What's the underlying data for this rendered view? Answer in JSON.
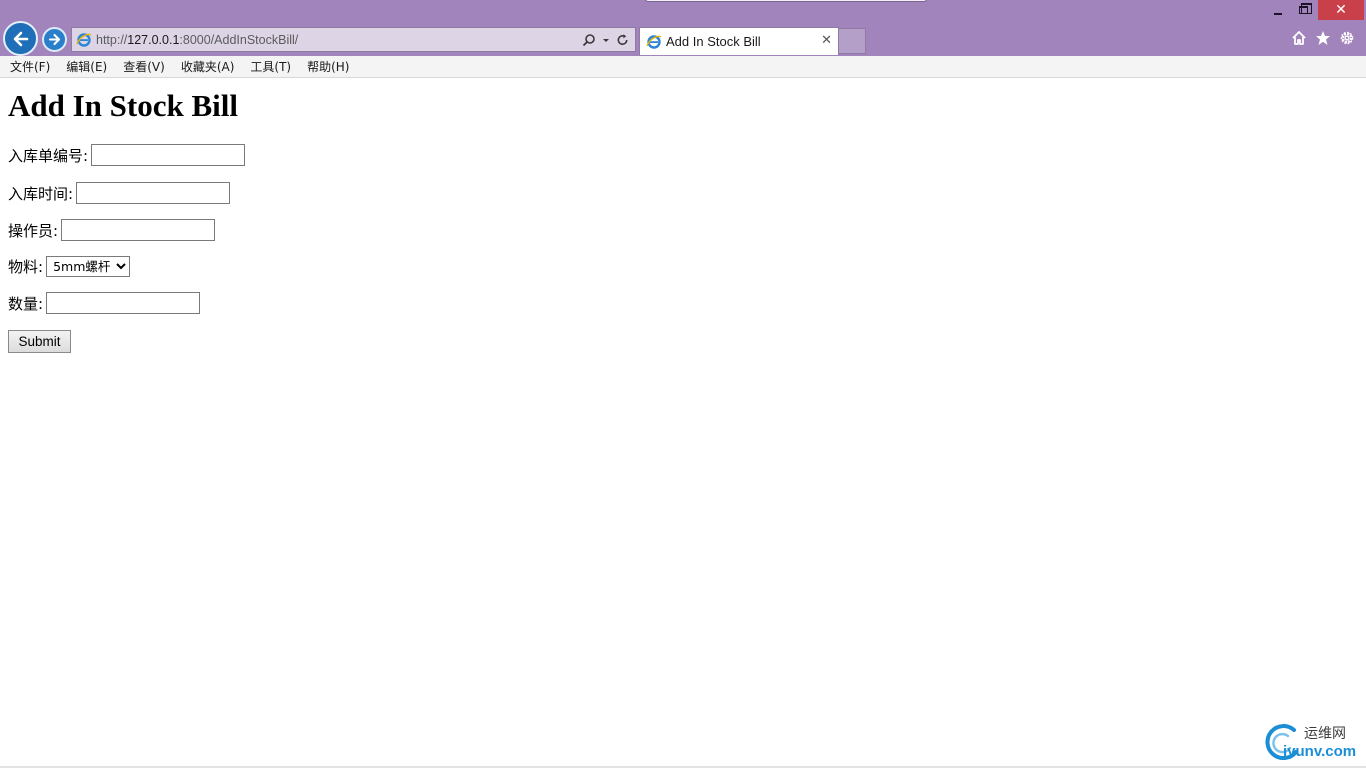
{
  "browser": {
    "address_prefix": "http://",
    "address_host": "127.0.0.1",
    "address_path": ":8000/AddInStockBill/",
    "tab_title": "Add In Stock Bill",
    "close_glyph": "✕",
    "win_close_glyph": "✕",
    "icons": [
      "back-icon",
      "forward-icon",
      "ie-logo-icon",
      "search-icon",
      "dropdown-icon",
      "refresh-icon",
      "home-icon",
      "favorites-icon",
      "gear-icon"
    ]
  },
  "menu": {
    "items": [
      "文件(F)",
      "编辑(E)",
      "查看(V)",
      "收藏夹(A)",
      "工具(T)",
      "帮助(H)"
    ]
  },
  "page": {
    "title": "Add In Stock Bill",
    "fields": {
      "bill_no": {
        "label": "入库单编号:",
        "value": ""
      },
      "in_time": {
        "label": "入库时间:",
        "value": ""
      },
      "operator": {
        "label": "操作员:",
        "value": ""
      },
      "material": {
        "label": "物料:",
        "selected": "5mm螺杆"
      },
      "quantity": {
        "label": "数量:",
        "value": ""
      }
    },
    "submit_label": "Submit"
  },
  "watermark": {
    "cn": "运维网",
    "en": "iyunv.com"
  },
  "colors": {
    "titlebar": "#a284bc",
    "close_button": "#c9404a",
    "nav_button": "#1e6fb8",
    "watermark_blue": "#1b8ed6"
  }
}
